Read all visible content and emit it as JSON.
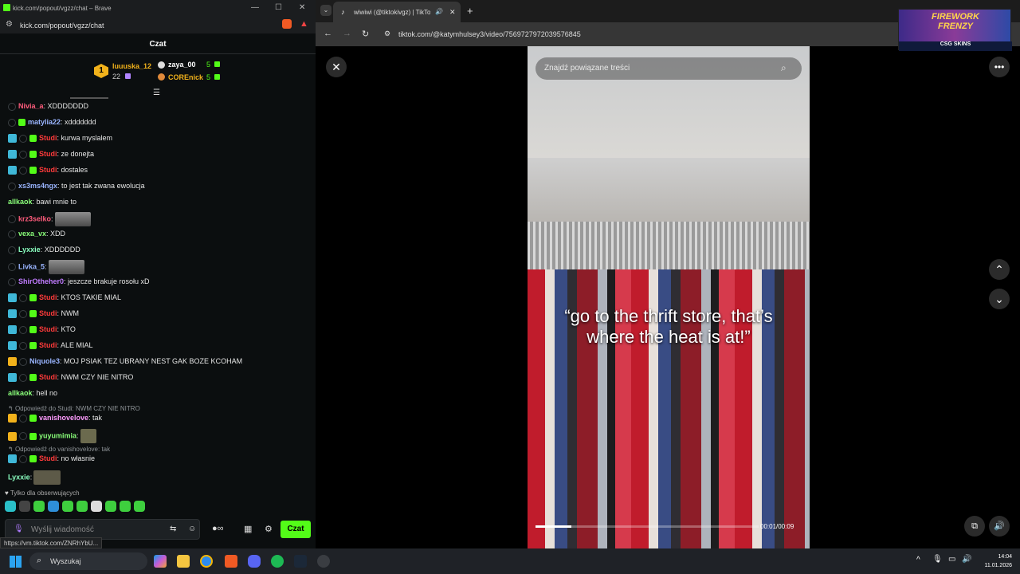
{
  "kick": {
    "window_title": "kick.com/popout/vgzz/chat – Brave",
    "url": "kick.com/popout/vgzz/chat",
    "header": "Czat",
    "gifters": [
      {
        "rank": "1",
        "name": "luuuska_12",
        "count": "22"
      },
      {
        "name": "zaya_00",
        "count": "5"
      },
      {
        "name": "COREnick",
        "count": "5"
      }
    ],
    "messages": [
      {
        "user": "Nivia_a",
        "color": "#ff5c7c",
        "text": ": XDDDDDDD"
      },
      {
        "user": "matylia22",
        "color": "#9ab5ff",
        "text": ": xddddddd"
      },
      {
        "user": "Studi",
        "color": "#ff3b3b",
        "text": ": kurwa myslalem"
      },
      {
        "user": "Studi",
        "color": "#ff3b3b",
        "text": ": ze donejta"
      },
      {
        "user": "Studi",
        "color": "#ff3b3b",
        "text": ": dostales"
      },
      {
        "user": "xs3ms4ngx",
        "color": "#9ab5ff",
        "text": ": to jest tak zwana ewolucja"
      },
      {
        "user": "allkaok",
        "color": "#8aff7a",
        "text": ": bawi mnie to"
      },
      {
        "user": "krz3selko",
        "color": "#ff5c7c",
        "text": ":"
      },
      {
        "user": "vexa_vx",
        "color": "#8aff7a",
        "text": ": XDD"
      },
      {
        "user": "Lyxxie",
        "color": "#8affc0",
        "text": ": XDDDDDD"
      },
      {
        "user": "Livka_5",
        "color": "#9ab5ff",
        "text": ":"
      },
      {
        "user": "ShirOtheher0",
        "color": "#c07bff",
        "text": ": jeszcze brakuje rosołu xD"
      },
      {
        "user": "Studi",
        "color": "#ff3b3b",
        "text": ": KTOS TAKIE MIAL"
      },
      {
        "user": "Studi",
        "color": "#ff3b3b",
        "text": ": NWM"
      },
      {
        "user": "Studi",
        "color": "#ff3b3b",
        "text": ": KTO"
      },
      {
        "user": "Studi",
        "color": "#ff3b3b",
        "text": ": ALE MIAL"
      },
      {
        "user": "Niquole3",
        "color": "#9ab5ff",
        "text": ": MOJ PSIAK TEZ UBRANY NEST GAK BOZE KCOHAM"
      },
      {
        "user": "Studi",
        "color": "#ff3b3b",
        "text": ": NWM CZY NIE NITRO"
      },
      {
        "user": "allkaok",
        "color": "#8aff7a",
        "text": ": hell no"
      },
      {
        "user": "vanishovelove",
        "color": "#ff9cff",
        "text": ": tak"
      },
      {
        "user": "yuyumimia",
        "color": "#8aff7a",
        "text": ":"
      },
      {
        "user": "Studi",
        "color": "#ff3b3b",
        "text": ": no własnie"
      },
      {
        "user": "Lyxxie",
        "color": "#8affc0",
        "text": ":"
      }
    ],
    "reply1": "Odpowiedź do Studi: NWM CZY NIE NITRO",
    "reply2": "Odpowiedź do vanishovelove: tak",
    "followers_only": "Tylko dla obserwujących",
    "input_placeholder": "Wyślij wiadomość",
    "send_label": "Czat",
    "status_url": "https://vm.tiktok.com/ZNRhYbU..."
  },
  "brave": {
    "tab_title": "wiwiwi (@tiktokivgz) | TikTok",
    "url": "tiktok.com/@katymhulsey3/video/7569727972039576845",
    "search_placeholder": "Znajdź powiązane treści",
    "caption_line1": "“go to the thrift store, that’s",
    "caption_line2": "where the heat is at!”",
    "time": "00:01/00:09",
    "progress": 0.16
  },
  "ad": {
    "line1": "FIREWORK",
    "line2": "FRENZY",
    "sponsor": "CSG SKINS"
  },
  "taskbar": {
    "search": "Wyszukaj",
    "time": "14:04",
    "date": "11.01.2026"
  }
}
